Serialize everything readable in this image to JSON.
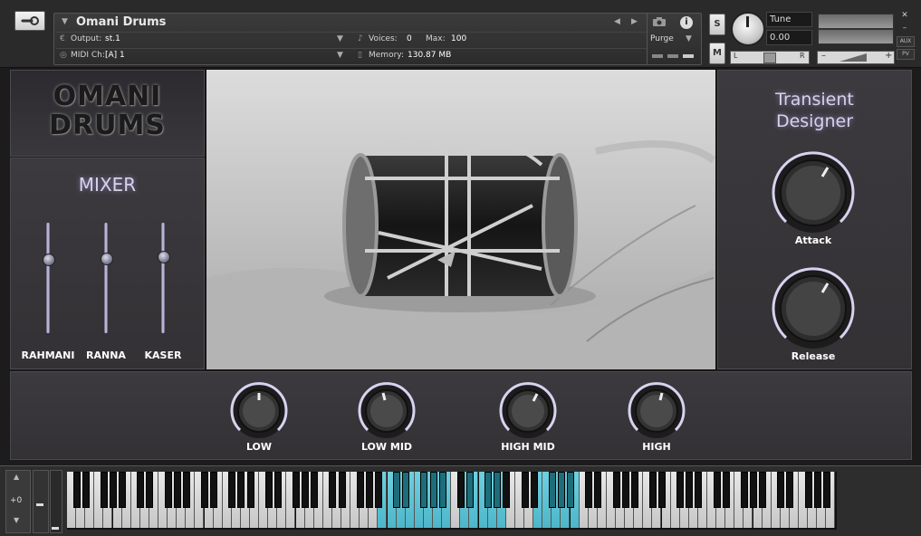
{
  "header": {
    "instrument_name": "Omani Drums",
    "output_label": "Output:",
    "output_value": "st.1",
    "midi_label": "MIDI Ch:",
    "midi_value": "[A]  1",
    "voices_label": "Voices:",
    "voices_value": "0",
    "max_label": "Max:",
    "max_value": "100",
    "memory_label": "Memory:",
    "memory_value": "130.87 MB",
    "purge_label": "Purge",
    "solo_label": "S",
    "mute_label": "M",
    "tune_label": "Tune",
    "tune_value": "0.00",
    "pan_left": "L",
    "pan_right": "R",
    "vol_minus": "–",
    "vol_plus": "+",
    "aux_label": "AUX",
    "pv_label": "PV",
    "close_glyph": "✕",
    "minimize_glyph": "–"
  },
  "logo": {
    "line1": "OMANI",
    "line2": "DRUMS"
  },
  "mixer": {
    "title": "MIXER",
    "channels": [
      {
        "label": "RAHMANI",
        "level": 0.67
      },
      {
        "label": "RANNA",
        "level": 0.68
      },
      {
        "label": "KASER",
        "level": 0.7
      }
    ]
  },
  "transient_designer": {
    "title_line1": "Transient",
    "title_line2": "Designer",
    "attack_label": "Attack",
    "release_label": "Release"
  },
  "eq": {
    "bands": [
      {
        "label": "LOW"
      },
      {
        "label": "LOW MID"
      },
      {
        "label": "HIGH MID"
      },
      {
        "label": "HIGH"
      }
    ]
  },
  "keyboard": {
    "octave_value": "+0",
    "highlighted_ranges": [
      [
        34,
        41
      ],
      [
        43,
        47
      ],
      [
        51,
        55
      ]
    ]
  },
  "colors": {
    "accent": "#d8d2e6",
    "key_highlight": "#4db6c9",
    "panel": "#38363a"
  }
}
